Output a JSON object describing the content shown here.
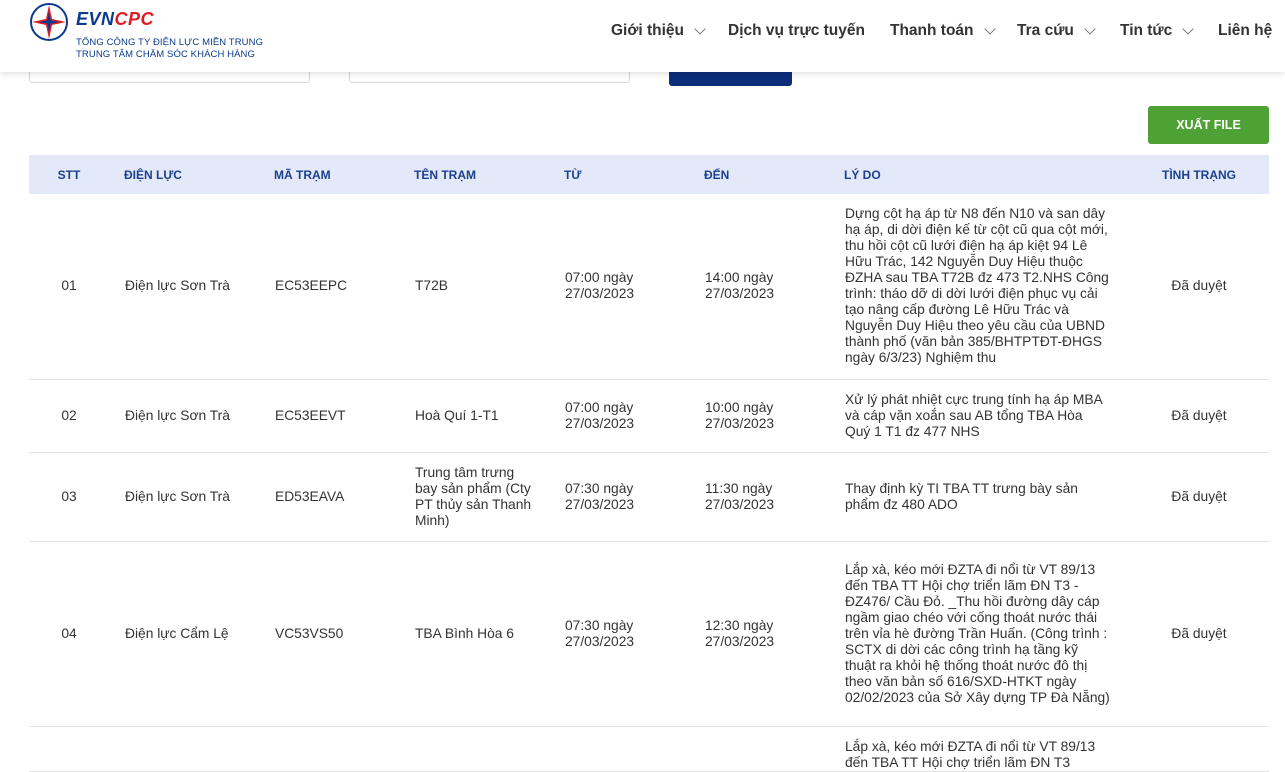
{
  "brand": {
    "evn": "EVN",
    "cpc": "CPC",
    "line1": "TỔNG CÔNG TY ĐIỆN LỰC MIỀN TRUNG",
    "line2": "TRUNG TÂM CHĂM SÓC KHÁCH HÀNG"
  },
  "nav": [
    {
      "label": "Giới thiệu",
      "dropdown": true
    },
    {
      "label": "Dịch vụ trực tuyến",
      "dropdown": false
    },
    {
      "label": "Thanh toán",
      "dropdown": true
    },
    {
      "label": "Tra cứu",
      "dropdown": true
    },
    {
      "label": "Tin tức",
      "dropdown": true
    },
    {
      "label": "Liên hệ",
      "dropdown": false
    }
  ],
  "toolbar": {
    "export_label": "XUẤT FILE"
  },
  "colors": {
    "brand_blue": "#0c3a8c",
    "brand_red": "#e11b22",
    "export_green": "#4ea135",
    "header_bg": "#e3e9f8",
    "header_text": "#1d3f8f"
  },
  "table": {
    "columns": [
      "STT",
      "ĐIỆN LỰC",
      "MÃ TRẠM",
      "TÊN TRẠM",
      "TỪ",
      "ĐẾN",
      "LÝ DO",
      "TÌNH TRẠNG"
    ],
    "rows": [
      {
        "stt": "01",
        "dien_luc": "Điện lực Sơn Trà",
        "ma_tram": "EC53EEPC",
        "ten_tram": "T72B",
        "tu": "07:00 ngày 27/03/2023",
        "den": "14:00 ngày 27/03/2023",
        "ly_do": "Dựng cột hạ áp từ N8 đến N10 và san dây hạ áp, di dời điện kế từ cột cũ qua cột mới, thu hồi cột cũ lưới điện hạ áp kiệt 94 Lê Hữu Trác, 142 Nguyễn Duy Hiệu thuộc ĐZHA sau TBA T72B đz 473 T2.NHS Công trình: tháo dỡ di dời lưới điện phục vụ cải tạo nâng cấp đường Lê Hữu Trác và Nguyễn Duy Hiệu theo yêu cầu của UBND thành phố (văn bản 385/BHTPTĐT-ĐHGS ngày 6/3/23) Nghiệm thu",
        "tinh_trang": "Đã duyệt"
      },
      {
        "stt": "02",
        "dien_luc": "Điện lực Sơn Trà",
        "ma_tram": "EC53EEVT",
        "ten_tram": "Hoà Quí 1-T1",
        "tu": "07:00 ngày 27/03/2023",
        "den": "10:00 ngày 27/03/2023",
        "ly_do": "Xử lý phát nhiệt cực trung tính hạ áp MBA và cáp vặn xoắn sau AB tổng TBA Hòa Quý 1 T1 đz 477 NHS",
        "tinh_trang": "Đã duyệt"
      },
      {
        "stt": "03",
        "dien_luc": "Điện lực Sơn Trà",
        "ma_tram": "ED53EAVA",
        "ten_tram": "Trung tâm trưng bay sản phẩm (Cty PT thủy sản Thanh Minh)",
        "tu": "07:30 ngày 27/03/2023",
        "den": "11:30 ngày 27/03/2023",
        "ly_do": "Thay định kỳ TI TBA TT trưng bày sản phẩm đz 480 ADO",
        "tinh_trang": "Đã duyệt"
      },
      {
        "stt": "04",
        "dien_luc": "Điện lực Cẩm Lệ",
        "ma_tram": "VC53VS50",
        "ten_tram": "TBA Bình Hòa 6",
        "tu": "07:30 ngày 27/03/2023",
        "den": "12:30 ngày 27/03/2023",
        "ly_do": "Lắp xà, kéo mới ĐZTA đi nổi từ VT 89/13 đến TBA TT Hội chợ triển lãm ĐN T3 - ĐZ476/ Cầu Đỏ. _Thu hồi đường dây cáp ngầm giao chéo với cống thoát nước thái trên vỉa hè đường Trần Huấn. (Công trình : SCTX di dời các công trình hạ tầng kỹ thuật ra khỏi hệ thống thoát nước đô thị theo văn bản số 616/SXD-HTKT ngày 02/02/2023 của Sở Xây dựng TP Đà Nẵng)",
        "tinh_trang": "Đã duyệt"
      },
      {
        "stt": "",
        "dien_luc": "",
        "ma_tram": "",
        "ten_tram": "",
        "tu": "",
        "den": "",
        "ly_do": "Lắp xà, kéo mới ĐZTA đi nổi từ VT 89/13 đến TBA TT Hội chợ triển lãm ĐN T3",
        "tinh_trang": ""
      }
    ]
  }
}
